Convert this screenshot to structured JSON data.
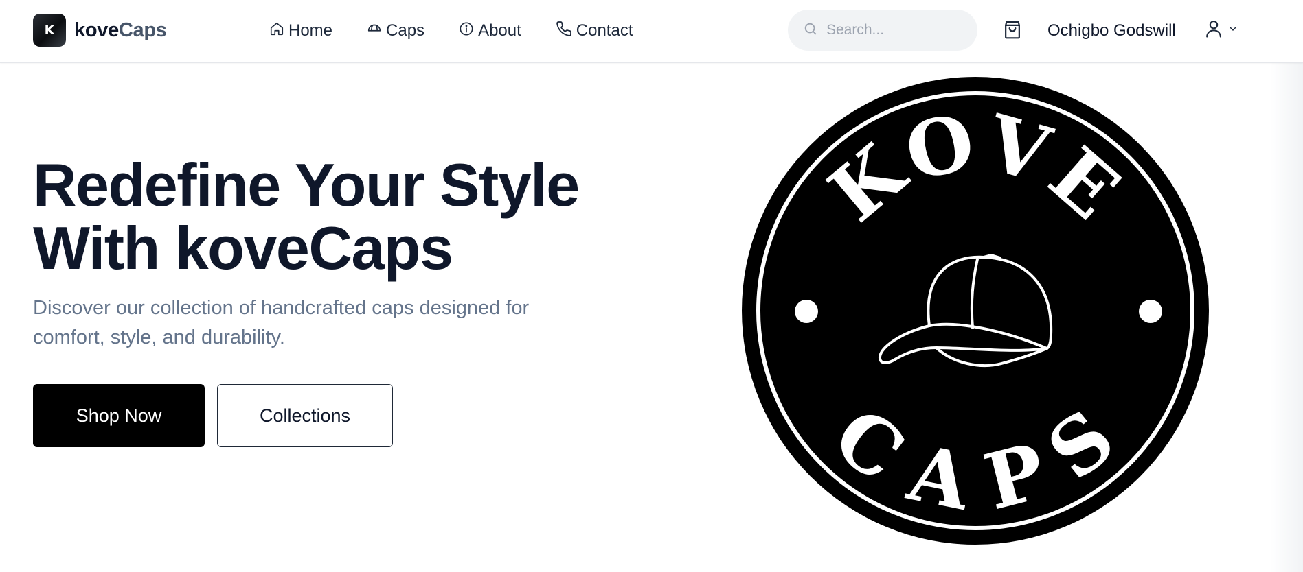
{
  "header": {
    "logo_letter": "K",
    "brand_part1": "kove",
    "brand_part2": "Caps",
    "nav": [
      {
        "label": "Home",
        "icon": "home-icon"
      },
      {
        "label": "Caps",
        "icon": "cap-icon"
      },
      {
        "label": "About",
        "icon": "info-icon"
      },
      {
        "label": "Contact",
        "icon": "phone-icon"
      }
    ],
    "search_placeholder": "Search...",
    "cart_icon": "shopping-bag-icon",
    "user_name": "Ochigbo Godswill",
    "user_icon": "user-icon"
  },
  "hero": {
    "title_line1": "Redefine Your Style",
    "title_line2": "With koveCaps",
    "subtitle": "Discover our collection of handcrafted caps designed for comfort, style, and durability.",
    "primary_button": "Shop Now",
    "secondary_button": "Collections"
  },
  "emblem": {
    "top_text": "KOVE",
    "bottom_text": "CAPS"
  },
  "colors": {
    "text_dark": "#0f172a",
    "muted": "#64748b",
    "search_bg": "#f1f3f5",
    "button_primary": "#000000"
  }
}
